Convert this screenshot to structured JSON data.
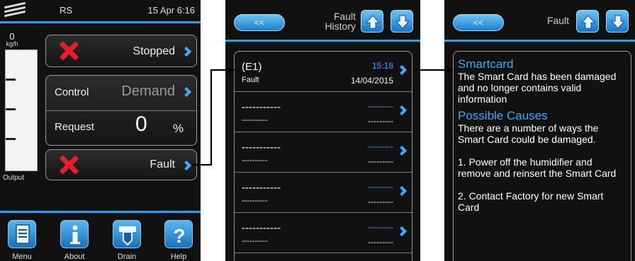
{
  "status": {
    "code": "RS",
    "datetime": "15 Apr 6:16"
  },
  "gauge": {
    "value": "0",
    "unit": "kg/h",
    "label": "Output"
  },
  "main": {
    "state_label": "Stopped",
    "control_label": "Control",
    "control_value": "Demand",
    "request_label": "Request",
    "request_value": "0",
    "request_unit": "%",
    "fault_label": "Fault"
  },
  "bottom_bar": [
    {
      "label": "Menu",
      "icon": "document-icon"
    },
    {
      "label": "About",
      "icon": "info-icon"
    },
    {
      "label": "Drain",
      "icon": "drain-icon"
    },
    {
      "label": "Help",
      "icon": "help-icon"
    }
  ],
  "history": {
    "back_label": "<<",
    "title_line1": "Fault",
    "title_line2": "History",
    "rows": [
      {
        "code": "(E1)",
        "type": "Fault",
        "time": "15:18",
        "date": "14/04/2015"
      },
      {
        "code": "-----------",
        "type": "----------",
        "time": "---------",
        "date": "---------"
      },
      {
        "code": "-----------",
        "type": "----------",
        "time": "---------",
        "date": "---------"
      },
      {
        "code": "-----------",
        "type": "----------",
        "time": "---------",
        "date": "---------"
      },
      {
        "code": "-----------",
        "type": "----------",
        "time": "---------",
        "date": "---------"
      }
    ]
  },
  "fault_detail": {
    "back_label": "<<",
    "title": "Fault",
    "heading": "Smartcard",
    "description": "The Smart Card has been damaged and no longer contains valid information",
    "causes_heading": "Possible Causes",
    "causes_intro": "There are a number of ways the Smart Card could be damaged.",
    "step1": "1. Power off the humidifier and remove     and reinsert the Smart Card",
    "step2": "2. Contact Factory for new Smart Card"
  },
  "colors": {
    "accent": "#3fa9ff",
    "separator": "#3a9bd8",
    "fault": "#e21f2b",
    "background": "#111111"
  }
}
